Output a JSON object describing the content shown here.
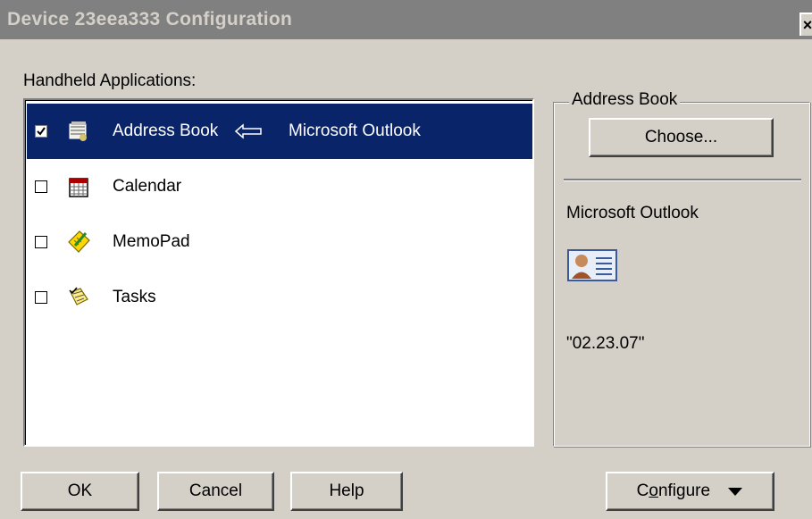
{
  "window": {
    "title": "Device  23eea333 Configuration",
    "close_label": "×"
  },
  "applications": {
    "label": "Handheld Applications:",
    "items": [
      {
        "label": "Address Book",
        "checked": true,
        "selected": true,
        "icon": "address-book-icon",
        "sync_arrow_icon": "left-arrow-icon",
        "sync_target": "Microsoft Outlook"
      },
      {
        "label": "Calendar",
        "checked": false,
        "selected": false,
        "icon": "calendar-icon",
        "sync_target": ""
      },
      {
        "label": "MemoPad",
        "checked": false,
        "selected": false,
        "icon": "memopad-icon",
        "sync_target": ""
      },
      {
        "label": "Tasks",
        "checked": false,
        "selected": false,
        "icon": "tasks-icon",
        "sync_target": ""
      }
    ]
  },
  "details": {
    "group_title": "Address Book",
    "choose_label": "Choose...",
    "app_name": "Microsoft Outlook",
    "app_icon": "contact-card-icon",
    "version": "\"02.23.07\""
  },
  "buttons": {
    "ok": "OK",
    "cancel": "Cancel",
    "help": "Help",
    "configure_prefix": "C",
    "configure_underline": "o",
    "configure_suffix": "nfigure",
    "configure_icon": "dropdown-triangle-icon"
  },
  "colors": {
    "dialog_bg": "#d4d0c8",
    "titlebar_bg": "#808080",
    "selection_bg": "#0a246a",
    "list_bg": "#ffffff"
  }
}
